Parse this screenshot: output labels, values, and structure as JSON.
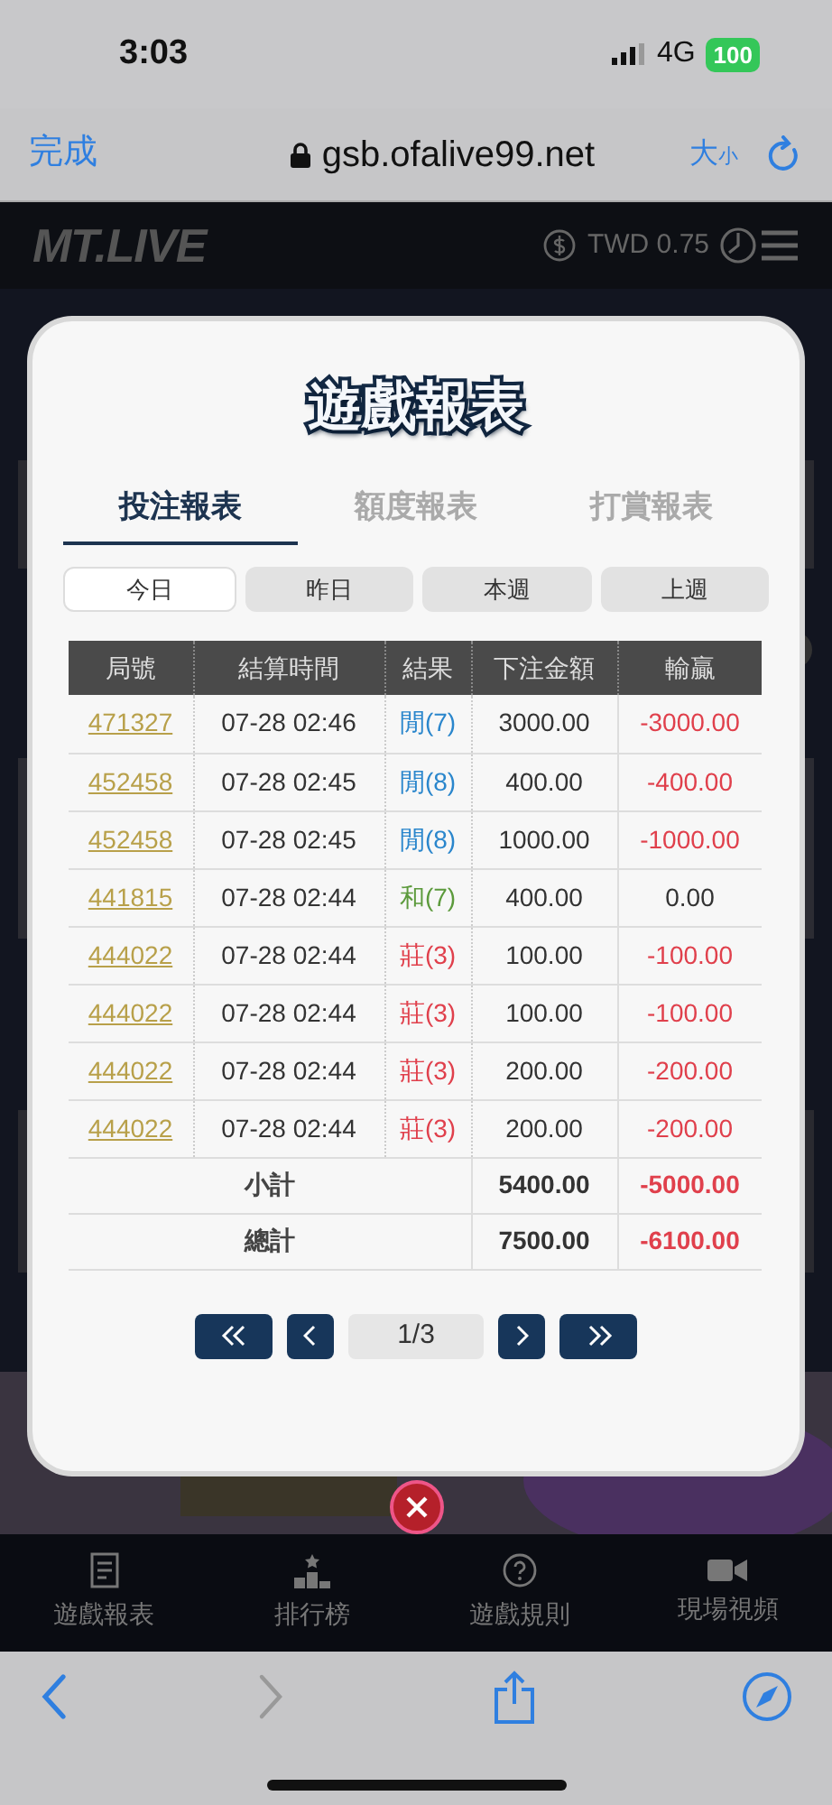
{
  "status_bar": {
    "time": "3:03",
    "network": "4G",
    "battery": "100"
  },
  "browser": {
    "done": "完成",
    "url": "gsb.ofalive99.net",
    "size_big": "大",
    "size_small": "小"
  },
  "site": {
    "logo": "MT.LIVE",
    "balance": "TWD 0.75"
  },
  "modal": {
    "title": "遊戲報表",
    "tabs": [
      {
        "label": "投注報表",
        "selected": true
      },
      {
        "label": "額度報表",
        "selected": false
      },
      {
        "label": "打賞報表",
        "selected": false
      }
    ],
    "periods": [
      {
        "label": "今日",
        "selected": true
      },
      {
        "label": "昨日",
        "selected": false
      },
      {
        "label": "本週",
        "selected": false
      },
      {
        "label": "上週",
        "selected": false
      }
    ],
    "columns": [
      "局號",
      "結算時間",
      "結果",
      "下注金額",
      "輸贏"
    ],
    "rows": [
      {
        "id": "471327",
        "time": "07-28 02:46",
        "result": "閒(7)",
        "kind": "player",
        "bet": "3000.00",
        "winloss": "-3000.00",
        "negative": true
      },
      {
        "id": "452458",
        "time": "07-28 02:45",
        "result": "閒(8)",
        "kind": "player",
        "bet": "400.00",
        "winloss": "-400.00",
        "negative": true
      },
      {
        "id": "452458",
        "time": "07-28 02:45",
        "result": "閒(8)",
        "kind": "player",
        "bet": "1000.00",
        "winloss": "-1000.00",
        "negative": true
      },
      {
        "id": "441815",
        "time": "07-28 02:44",
        "result": "和(7)",
        "kind": "tie",
        "bet": "400.00",
        "winloss": "0.00",
        "negative": false
      },
      {
        "id": "444022",
        "time": "07-28 02:44",
        "result": "莊(3)",
        "kind": "banker",
        "bet": "100.00",
        "winloss": "-100.00",
        "negative": true
      },
      {
        "id": "444022",
        "time": "07-28 02:44",
        "result": "莊(3)",
        "kind": "banker",
        "bet": "100.00",
        "winloss": "-100.00",
        "negative": true
      },
      {
        "id": "444022",
        "time": "07-28 02:44",
        "result": "莊(3)",
        "kind": "banker",
        "bet": "200.00",
        "winloss": "-200.00",
        "negative": true
      },
      {
        "id": "444022",
        "time": "07-28 02:44",
        "result": "莊(3)",
        "kind": "banker",
        "bet": "200.00",
        "winloss": "-200.00",
        "negative": true
      }
    ],
    "summary": [
      {
        "label": "小計",
        "bet": "5400.00",
        "winloss": "-5000.00",
        "negative": true
      },
      {
        "label": "總計",
        "bet": "7500.00",
        "winloss": "-6100.00",
        "negative": true
      }
    ],
    "page": "1/3"
  },
  "bottom_nav": [
    {
      "label": "遊戲報表",
      "kind": "report"
    },
    {
      "label": "排行榜",
      "kind": "ranking"
    },
    {
      "label": "遊戲規則",
      "kind": "rules"
    },
    {
      "label": "現場視頻",
      "kind": "video"
    }
  ]
}
